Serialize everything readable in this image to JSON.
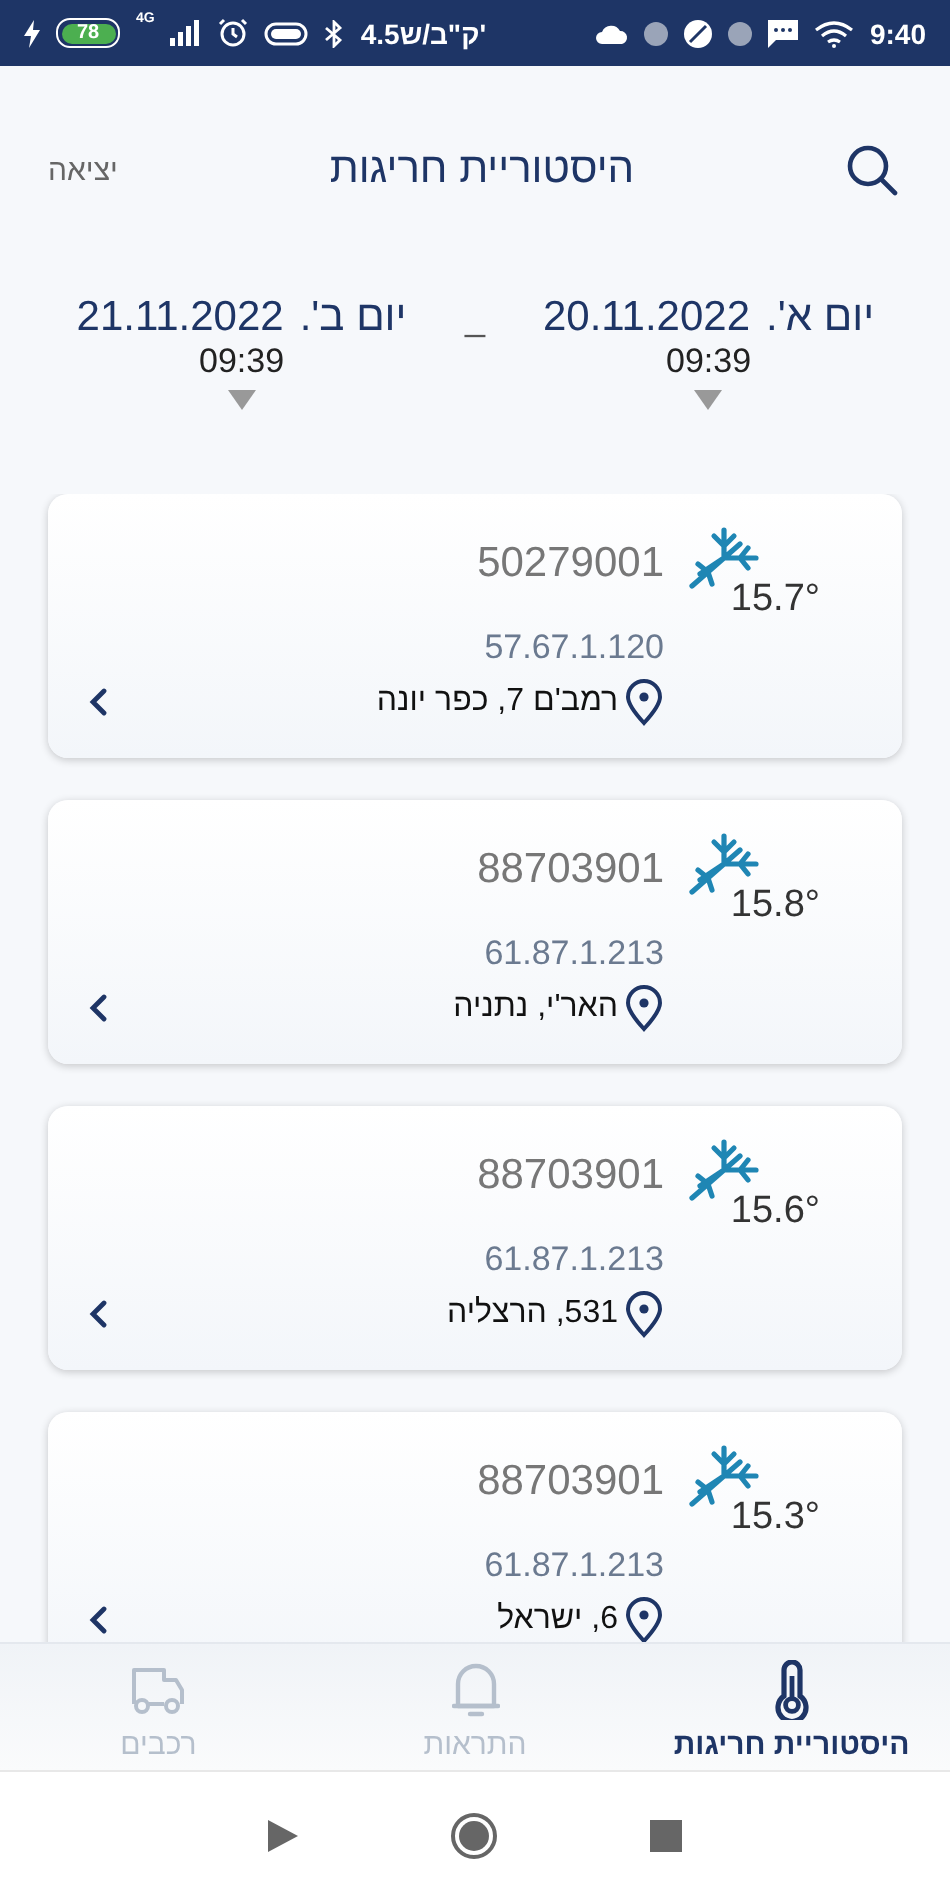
{
  "status_bar": {
    "battery": "78",
    "network": "4G",
    "speed": "4.5ק\"ב/ש'",
    "time": "9:40"
  },
  "header": {
    "title": "היסטוריית חריגות",
    "exit": "יציאה"
  },
  "date_range": {
    "from": {
      "day": "יום א'.",
      "date": "20.11.2022",
      "time": "09:39"
    },
    "separator": "_",
    "to": {
      "day": "יום ב'.",
      "date": "21.11.2022",
      "time": "09:39"
    }
  },
  "events": [
    {
      "id": "50279001",
      "temperature": "15.7°",
      "code": "57.67.1.120",
      "address": "רמב'ם 7, כפר יונה"
    },
    {
      "id": "88703901",
      "temperature": "15.8°",
      "code": "61.87.1.213",
      "address": "האר'י, נתניה"
    },
    {
      "id": "88703901",
      "temperature": "15.6°",
      "code": "61.87.1.213",
      "address": "531, הרצליה"
    },
    {
      "id": "88703901",
      "temperature": "15.3°",
      "code": "61.87.1.213",
      "address": "6, ישראל"
    }
  ],
  "tabs": [
    {
      "label": "היסטוריית חריגות",
      "kind": "thermometer",
      "selected": true
    },
    {
      "label": "התראות",
      "kind": "bell",
      "selected": false
    },
    {
      "label": "רכבים",
      "kind": "truck",
      "selected": false
    }
  ]
}
